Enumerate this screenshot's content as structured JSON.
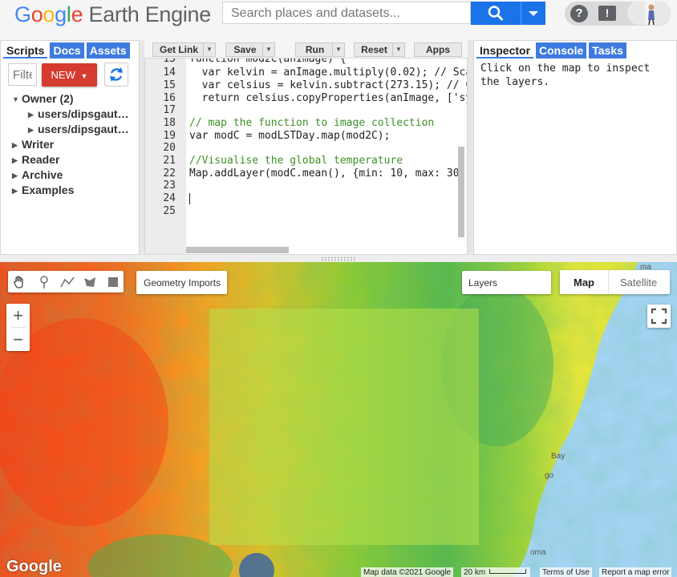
{
  "header": {
    "logo_google": "Google",
    "logo_product": "Earth Engine",
    "search_placeholder": "Search places and datasets...",
    "help_label": "?",
    "feedback_label": "!"
  },
  "left_panel": {
    "tabs": [
      "Scripts",
      "Docs",
      "Assets"
    ],
    "filter_placeholder": "Filte",
    "new_label": "NEW",
    "tree": [
      {
        "label": "Owner (2)",
        "expanded": true
      },
      {
        "label": "users/dipsgaut…",
        "child": true
      },
      {
        "label": "users/dipsgaut…",
        "child": true
      },
      {
        "label": "Writer"
      },
      {
        "label": "Reader"
      },
      {
        "label": "Archive"
      },
      {
        "label": "Examples"
      }
    ]
  },
  "toolbar": {
    "get_link": "Get Link",
    "save": "Save",
    "run": "Run",
    "reset": "Reset",
    "apps": "Apps"
  },
  "editor": {
    "line_numbers": [
      "13",
      "14",
      "15",
      "16",
      "17",
      "18",
      "19",
      "20",
      "21",
      "22",
      "23",
      "24",
      "25"
    ],
    "lines": [
      "function mod2C(anImage) {",
      "  var kelvin = anImage.multiply(0.02); // Scal",
      "  var celsius = kelvin.subtract(273.15); // Co",
      "  return celsius.copyProperties(anImage, ['sys",
      "",
      "// map the function to image collection",
      "var modC = modLSTDay.map(mod2C);",
      "",
      "//Visualise the global temperature",
      "Map.addLayer(modC.mean(), {min: 10, max: 30, p",
      "",
      "",
      ""
    ]
  },
  "right_panel": {
    "tabs": [
      "Inspector",
      "Console",
      "Tasks"
    ],
    "inspector_text": "Click on the map to inspect\nthe layers."
  },
  "map": {
    "geometry_imports": "Geometry Imports",
    "layers": "Layers",
    "map_type_map": "Map",
    "map_type_satellite": "Satellite",
    "zoom_in": "+",
    "zoom_out": "−",
    "google_logo": "Google",
    "map_data": "Map data ©2021 Google",
    "scale": "20 km",
    "terms": "Terms of Use",
    "report": "Report a map error",
    "labels": [
      "ma",
      "Bay",
      "go",
      "oma"
    ]
  },
  "colors": {
    "accent_blue": "#3f7ae0",
    "search_blue": "#1a73e8",
    "new_red": "#d63b30",
    "ocean": "#a6d4f6"
  }
}
